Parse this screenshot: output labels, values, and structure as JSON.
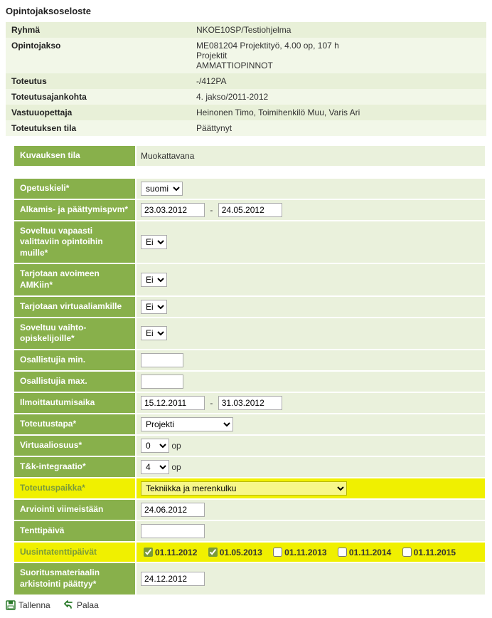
{
  "page_title": "Opintojaksoseloste",
  "info": {
    "group_label": "Ryhmä",
    "group_value": "NKOE10SP/Testiohjelma",
    "course_label": "Opintojakso",
    "course_line1": "ME081204 Projektityö, 4.00 op, 107 h",
    "course_line2": "Projektit",
    "course_line3": "AMMATTIOPINNOT",
    "impl_label": "Toteutus",
    "impl_value": "-/412PA",
    "period_label": "Toteutusajankohta",
    "period_value": "4. jakso/2011-2012",
    "teacher_label": "Vastuuopettaja",
    "teacher_value": "Heinonen Timo, Toimihenkilö Muu, Varis Ari",
    "status_label": "Toteutuksen tila",
    "status_value": "Päättynyt"
  },
  "form": {
    "desc_status_label": "Kuvauksen tila",
    "desc_status_value": "Muokattavana",
    "lang_label": "Opetuskieli*",
    "lang_value": "suomi",
    "dates_label": "Alkamis- ja päättymispvm*",
    "date_start": "23.03.2012",
    "date_end": "24.05.2012",
    "free_label": "Soveltuu vapaasti valittaviin opintoihin muille*",
    "free_value": "Ei",
    "open_label": "Tarjotaan avoimeen AMKiin*",
    "open_value": "Ei",
    "virtual_offer_label": "Tarjotaan virtuaaliamkille",
    "virtual_offer_value": "Ei",
    "exchange_label": "Soveltuu vaihto-opiskelijoille*",
    "exchange_value": "Ei",
    "min_label": "Osallistujia min.",
    "min_value": "",
    "max_label": "Osallistujia max.",
    "max_value": "",
    "enroll_label": "Ilmoittautumisaika",
    "enroll_start": "15.12.2011",
    "enroll_end": "31.03.2012",
    "method_label": "Toteutustapa*",
    "method_value": "Projekti",
    "virtual_share_label": "Virtuaaliosuus*",
    "virtual_share_value": "0",
    "tk_label": "T&k-integraatio*",
    "tk_value": "4",
    "op_unit": "op",
    "place_label": "Toteutuspaikka*",
    "place_value": "Tekniikka ja merenkulku",
    "assess_label": "Arviointi viimeistään",
    "assess_value": "24.06.2012",
    "exam_label": "Tenttipäivä",
    "exam_value": "",
    "retake_label": "Uusintatenttipäivät",
    "retake_dates": [
      {
        "label": "01.11.2012",
        "checked": true
      },
      {
        "label": "01.05.2013",
        "checked": true
      },
      {
        "label": "01.11.2013",
        "checked": false
      },
      {
        "label": "01.11.2014",
        "checked": false
      },
      {
        "label": "01.11.2015",
        "checked": false
      }
    ],
    "archive_label": "Suoritusmateriaalin arkistointi päättyy*",
    "archive_value": "24.12.2012"
  },
  "buttons": {
    "save": "Tallenna",
    "back": "Palaa"
  },
  "dash": "-"
}
